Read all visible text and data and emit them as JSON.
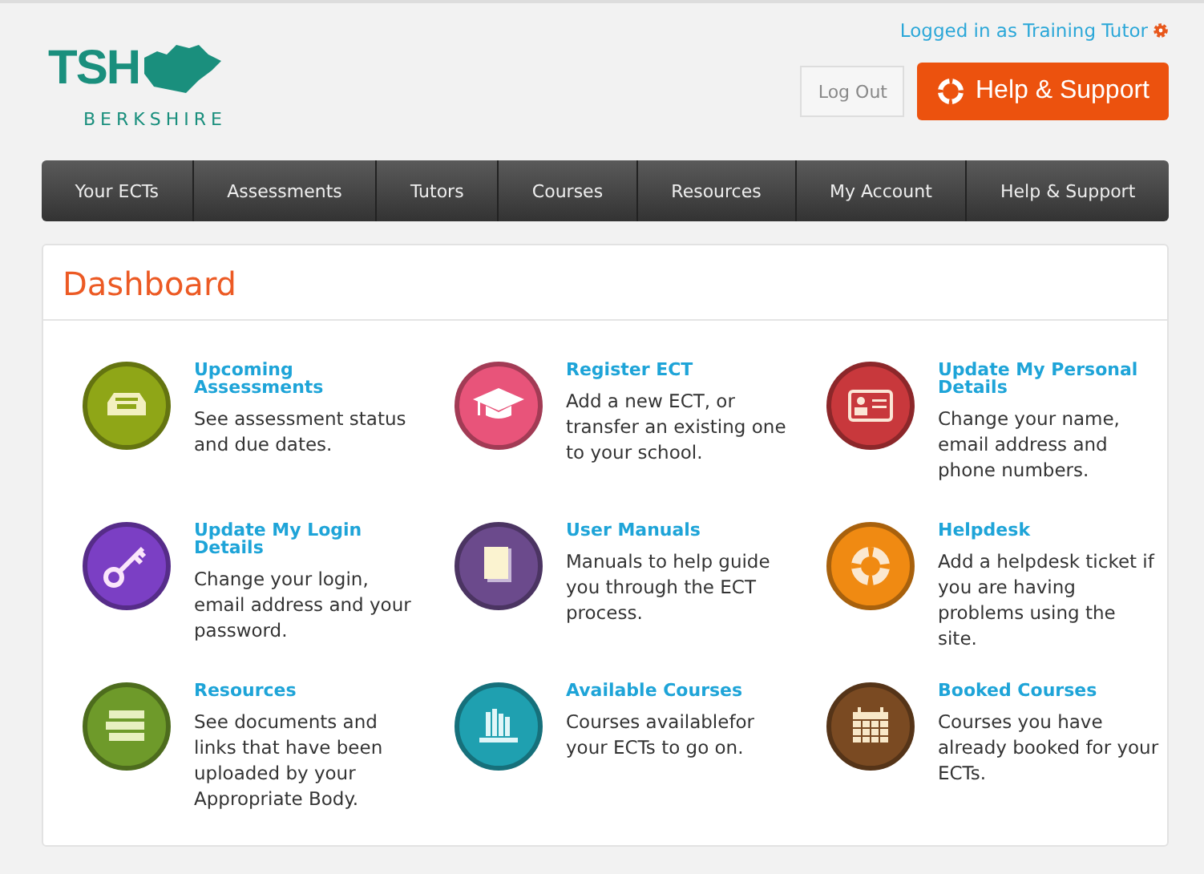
{
  "header": {
    "logo_text": "TSH",
    "logo_subtext": "BERKSHIRE",
    "login_status": "Logged in as Training Tutor",
    "logout_button": "Log Out",
    "help_button": "Help & Support"
  },
  "nav": [
    {
      "label": "Your ECTs"
    },
    {
      "label": "Assessments"
    },
    {
      "label": "Tutors"
    },
    {
      "label": "Courses"
    },
    {
      "label": "Resources"
    },
    {
      "label": "My Account"
    },
    {
      "label": "Help & Support"
    }
  ],
  "dashboard": {
    "title": "Dashboard",
    "tiles": [
      {
        "kind": "tray",
        "color": "#8fa617",
        "title": "Upcoming Assessments",
        "description": "See assessment status and due dates."
      },
      {
        "kind": "cap",
        "color": "#e8547a",
        "title": "Register ECT",
        "description": "Add a new ECT, or transfer an existing one to your school."
      },
      {
        "kind": "card",
        "color": "#c8383c",
        "title": "Update My Personal Details",
        "description": "Change your name, email address and phone numbers."
      },
      {
        "kind": "key",
        "color": "#7b3fc4",
        "title": "Update My Login Details",
        "description": "Change your login, email address and your password."
      },
      {
        "kind": "book",
        "color": "#6b4a8c",
        "title": "User Manuals",
        "description": "Manuals to help guide you through the ECT process."
      },
      {
        "kind": "ring",
        "color": "#f08a12",
        "title": "Helpdesk",
        "description": "Add a helpdesk ticket if you are having problems using the site."
      },
      {
        "kind": "stack",
        "color": "#6e9a2a",
        "title": "Resources",
        "description": "See documents and links that have been uploaded by your Appropriate Body."
      },
      {
        "kind": "shelf",
        "color": "#1fa0b0",
        "title": "Available Courses",
        "description": "Courses availablefor your ECTs to go on."
      },
      {
        "kind": "calendar",
        "color": "#7a4a22",
        "title": "Booked Courses",
        "description": "Courses you have already booked for your ECTs."
      }
    ]
  }
}
